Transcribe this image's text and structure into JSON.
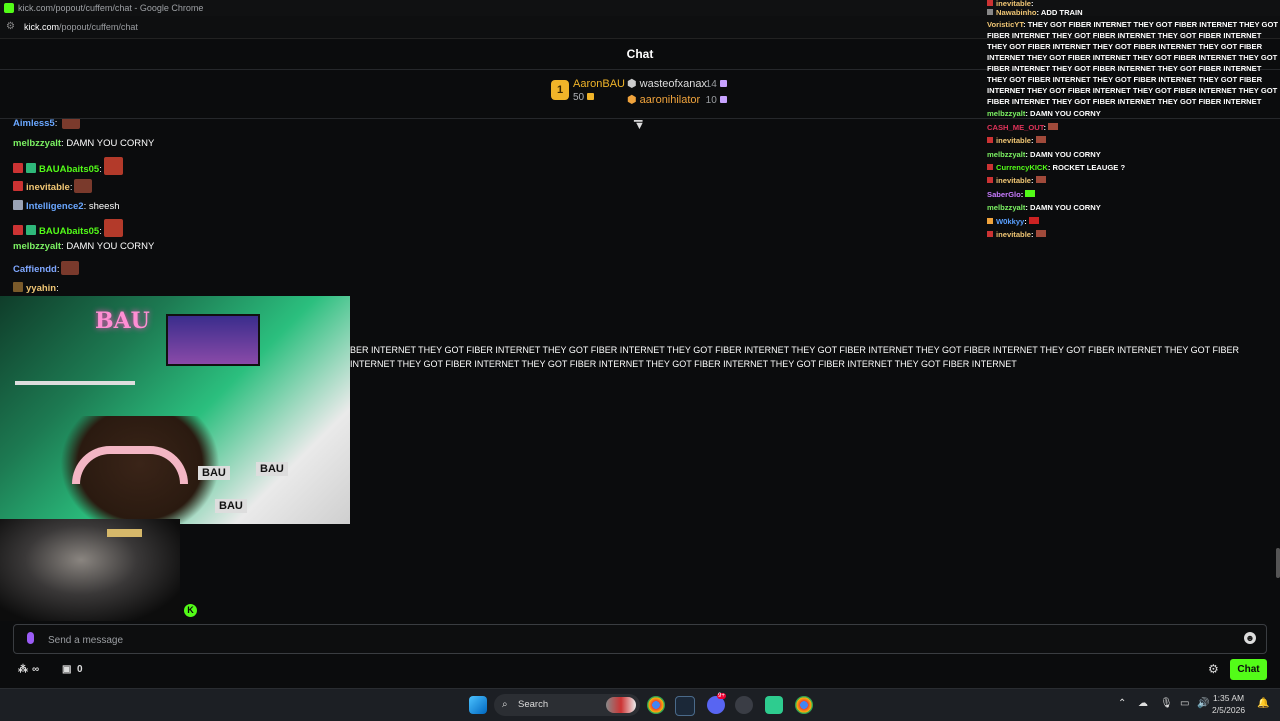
{
  "browser": {
    "title": "kick.com/popout/cuffem/chat - Google Chrome",
    "url_host": "kick.com",
    "url_path": "/popout/cuffem/chat"
  },
  "header": {
    "title": "Chat"
  },
  "gifters": {
    "rank": "1",
    "top": {
      "name": "AaronBAU",
      "count": "50"
    },
    "second": {
      "name": "wasteofxanax",
      "count": "14"
    },
    "third": {
      "name": "aaronihilator",
      "count": "10"
    }
  },
  "messages": [
    {
      "user": "melbzzyalt",
      "text": ": DAMN YOU CORNY",
      "color": "#7cf263"
    },
    {
      "user": "BAUAbaits05",
      "text": ":",
      "color": "#53fc18"
    },
    {
      "user": "inevitable",
      "text": ":",
      "color": "#f0c674"
    },
    {
      "user": "Intelligence2",
      "text": ": sheesh",
      "color": "#6aa7ff"
    },
    {
      "user": "BAUAbaits05",
      "text": ":",
      "color": "#53fc18"
    },
    {
      "user": "melbzzyalt",
      "text": ": DAMN YOU CORNY",
      "color": "#7cf263"
    },
    {
      "user": "Caffiendd",
      "text": ":",
      "color": "#7fa7ff"
    },
    {
      "user": "yyahin",
      "text": ":",
      "color": "#f0c674"
    }
  ],
  "overlay_text": "BER INTERNET THEY GOT FIBER INTERNET THEY GOT FIBER INTERNET THEY GOT FIBER INTERNET THEY GOT FIBER INTERNET THEY GOT FIBER INTERNET THEY GOT FIBER INTERNET THEY GOT FIBER INTERNET THEY GOT FIBER INTERNET THEY GOT FIBER INTERNET THEY GOT FIBER INTERNET THEY GOT FIBER INTERNET THEY GOT FIBER INTERNET",
  "overlay_chat": [
    {
      "user": "Nawabinho",
      "text": ": ADD TRAIN",
      "color": "#f0c674"
    },
    {
      "user": "VoristicYT",
      "text": ": THEY GOT FIBER INTERNET THEY GOT FIBER INTERNET THEY GOT FIBER INTERNET THEY GOT FIBER INTERNET THEY GOT FIBER INTERNET THEY GOT FIBER INTERNET THEY GOT FIBER INTERNET THEY GOT FIBER INTERNET THEY GOT FIBER INTERNET THEY GOT FIBER INTERNET THEY GOT FIBER INTERNET THEY GOT FIBER INTERNET THEY GOT FIBER INTERNET THEY GOT FIBER INTERNET THEY GOT FIBER INTERNET THEY GOT FIBER INTERNET THEY GOT FIBER INTERNET THEY GOT FIBER INTERNET THEY GOT FIBER INTERNET THEY GOT FIBER INTERNET THEY GOT FIBER INTERNET",
      "color": "#f0c674"
    },
    {
      "user": "melbzzyalt",
      "text": ": DAMN YOU CORNY",
      "color": "#7cf263"
    },
    {
      "user": "CASH_ME_OUT",
      "text": ":",
      "color": "#e0335a"
    },
    {
      "user": "inevitable",
      "text": ":",
      "color": "#f0c674"
    },
    {
      "user": "melbzzyalt",
      "text": ": DAMN YOU CORNY",
      "color": "#7cf263"
    },
    {
      "user": "CurrencyKICK",
      "text": ": ROCKET LEAUGE ?",
      "color": "#53fc18"
    },
    {
      "user": "inevitable",
      "text": ":",
      "color": "#f0c674"
    },
    {
      "user": "SaberGlo",
      "text": ":",
      "color": "#c87bff"
    },
    {
      "user": "melbzzyalt",
      "text": ": DAMN YOU CORNY",
      "color": "#7cf263"
    },
    {
      "user": "W0kkyy",
      "text": ":",
      "color": "#5aa0ff"
    },
    {
      "user": "inevitable",
      "text": ":",
      "color": "#f0c674"
    }
  ],
  "input": {
    "placeholder": "Send a message"
  },
  "footer": {
    "viewers_symbol": "∞",
    "gift_count": "0",
    "chat_button": "Chat"
  },
  "stream_signs": {
    "neon": "BAU",
    "sign1": "BAU",
    "sign2": "BAU",
    "sign3": "BAU"
  },
  "taskbar": {
    "search_label": "Search",
    "discord_badge": "9+",
    "time": "1:35 AM",
    "date": "2/5/2026"
  },
  "colors": {
    "accent": "#53fc18",
    "gold": "#f0b429",
    "background": "#0b0c0d"
  }
}
